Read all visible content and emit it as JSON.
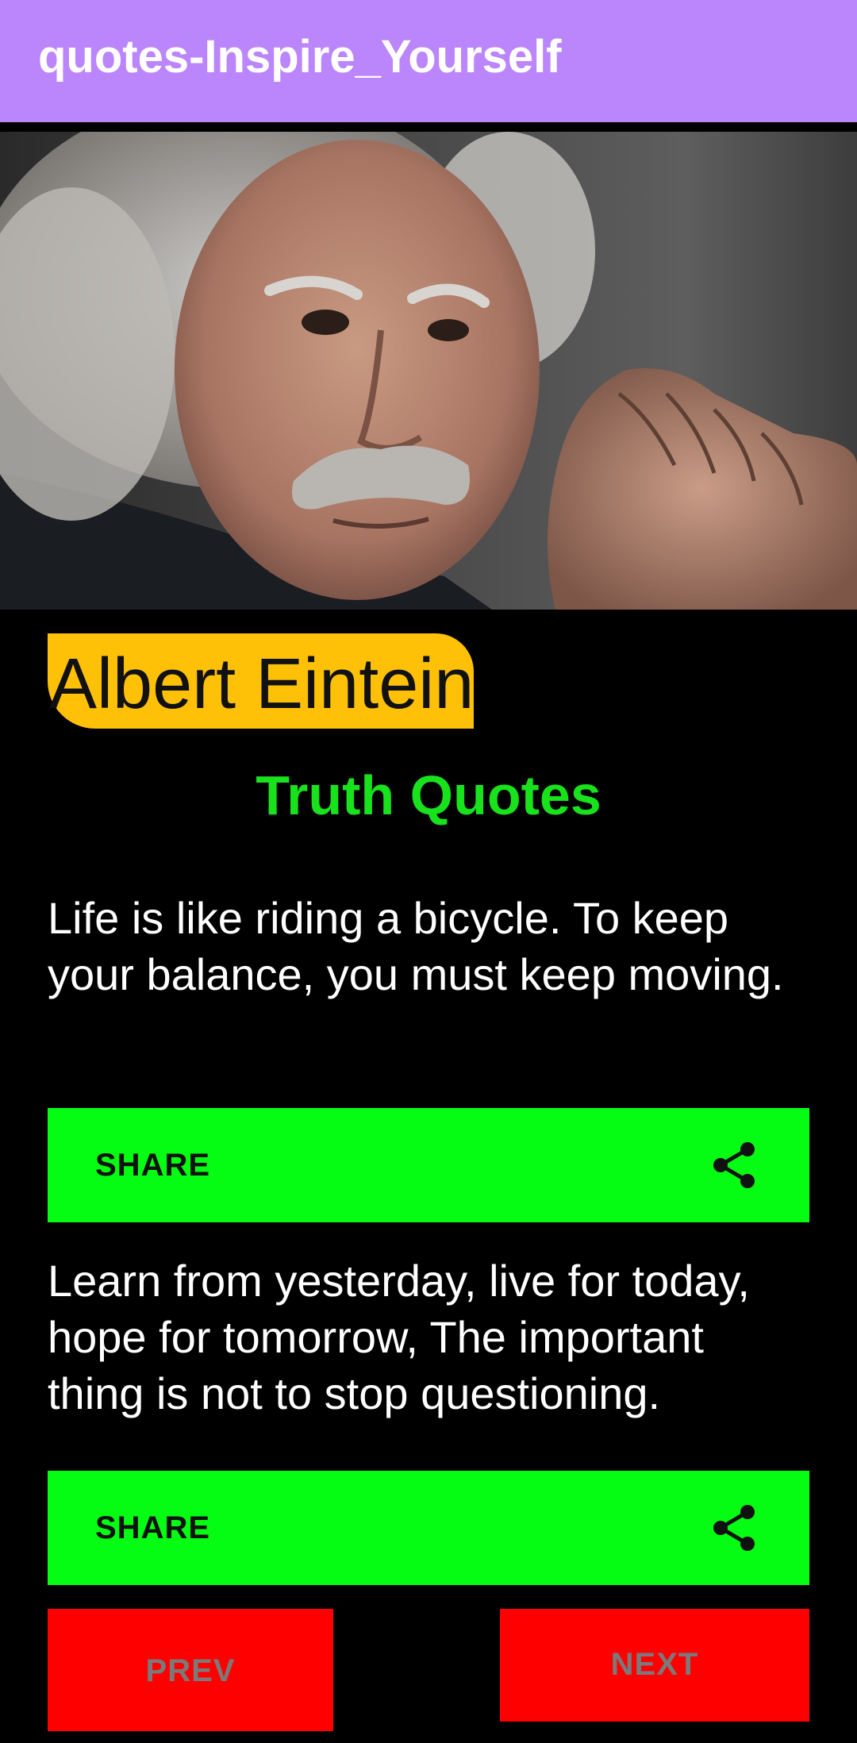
{
  "app_bar": {
    "title": "quotes-Inspire_Yourself",
    "color": "#bb86fc"
  },
  "author": {
    "name": "Albert Eintein",
    "badge_color": "#ffc107"
  },
  "category": {
    "title": "Truth Quotes",
    "color": "#18e21c"
  },
  "quotes": [
    {
      "text": "Life is like riding a bicycle. To keep your balance, you must keep moving.",
      "share_label": "SHARE",
      "share_icon": "share-icon"
    },
    {
      "text": "Learn from yesterday, live for today, hope for tomorrow, The important thing is not to stop questioning.",
      "share_label": "SHARE",
      "share_icon": "share-icon"
    }
  ],
  "navigation": {
    "prev_label": "PREV",
    "next_label": "NEXT",
    "button_color": "#ff0000"
  }
}
